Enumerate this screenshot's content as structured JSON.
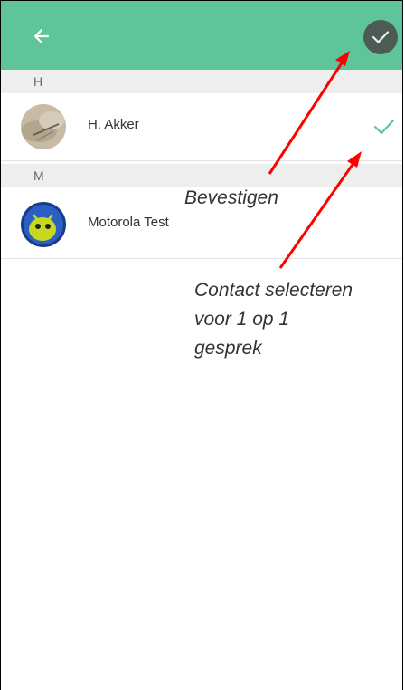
{
  "app_bar": {
    "back_icon": "arrow-left-icon",
    "confirm_icon": "check-icon",
    "color": "#5ec49a",
    "confirm_bg": "#4d5b55"
  },
  "sections": [
    {
      "letter": "H",
      "contacts": [
        {
          "name": "H. Akker",
          "selected": true,
          "avatar_icon": "photo-avatar"
        }
      ]
    },
    {
      "letter": "M",
      "contacts": [
        {
          "name": "Motorola Test",
          "selected": false,
          "avatar_icon": "android-avatar"
        }
      ]
    }
  ],
  "annotations": {
    "confirm": "Bevestigen",
    "select_line1": "Contact selecteren",
    "select_line2": "voor 1 op 1",
    "select_line3": "gesprek",
    "arrow_color": "#ff0000"
  },
  "check_color": "#5ec49a"
}
